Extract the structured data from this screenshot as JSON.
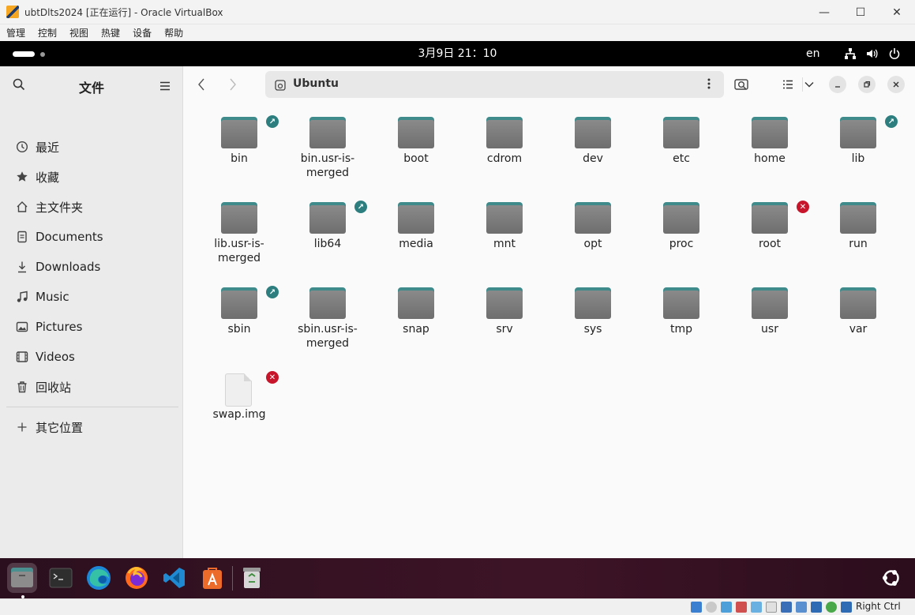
{
  "window": {
    "title": "ubtDlts2024 [正在运行] - Oracle VirtualBox",
    "minimize": "—",
    "maximize": "☐",
    "close": "✕"
  },
  "vbox_menu": [
    "管理",
    "控制",
    "视图",
    "热键",
    "设备",
    "帮助"
  ],
  "topbar": {
    "clock": "3月9日  21：10",
    "lang": "en"
  },
  "sidebar": {
    "title": "文件",
    "items": [
      {
        "label": "最近",
        "icon": "clock-icon"
      },
      {
        "label": "收藏",
        "icon": "star-icon"
      },
      {
        "label": "主文件夹",
        "icon": "home-icon"
      },
      {
        "label": "Documents",
        "icon": "document-icon"
      },
      {
        "label": "Downloads",
        "icon": "download-icon"
      },
      {
        "label": "Music",
        "icon": "music-icon"
      },
      {
        "label": "Pictures",
        "icon": "picture-icon"
      },
      {
        "label": "Videos",
        "icon": "video-icon"
      },
      {
        "label": "回收站",
        "icon": "trash-icon"
      }
    ],
    "other": {
      "label": "其它位置",
      "icon": "plus-icon"
    }
  },
  "pathbar": {
    "location": "Ubuntu"
  },
  "files": [
    {
      "name": "bin",
      "type": "folder",
      "badge": "link"
    },
    {
      "name": "bin.usr-is-merged",
      "type": "folder",
      "badge": ""
    },
    {
      "name": "boot",
      "type": "folder",
      "badge": ""
    },
    {
      "name": "cdrom",
      "type": "folder",
      "badge": ""
    },
    {
      "name": "dev",
      "type": "folder",
      "badge": ""
    },
    {
      "name": "etc",
      "type": "folder",
      "badge": ""
    },
    {
      "name": "home",
      "type": "folder",
      "badge": ""
    },
    {
      "name": "lib",
      "type": "folder",
      "badge": "link"
    },
    {
      "name": "lib.usr-is-merged",
      "type": "folder",
      "badge": ""
    },
    {
      "name": "lib64",
      "type": "folder",
      "badge": "link"
    },
    {
      "name": "media",
      "type": "folder",
      "badge": ""
    },
    {
      "name": "mnt",
      "type": "folder",
      "badge": ""
    },
    {
      "name": "opt",
      "type": "folder",
      "badge": ""
    },
    {
      "name": "proc",
      "type": "folder",
      "badge": ""
    },
    {
      "name": "root",
      "type": "folder",
      "badge": "lock"
    },
    {
      "name": "run",
      "type": "folder",
      "badge": ""
    },
    {
      "name": "sbin",
      "type": "folder",
      "badge": "link"
    },
    {
      "name": "sbin.usr-is-merged",
      "type": "folder",
      "badge": ""
    },
    {
      "name": "snap",
      "type": "folder",
      "badge": ""
    },
    {
      "name": "srv",
      "type": "folder",
      "badge": ""
    },
    {
      "name": "sys",
      "type": "folder",
      "badge": ""
    },
    {
      "name": "tmp",
      "type": "folder",
      "badge": ""
    },
    {
      "name": "usr",
      "type": "folder",
      "badge": ""
    },
    {
      "name": "var",
      "type": "folder",
      "badge": ""
    },
    {
      "name": "swap.img",
      "type": "file",
      "badge": "lock"
    }
  ],
  "dock": [
    "files-app-icon",
    "terminal-app-icon",
    "edge-app-icon",
    "firefox-app-icon",
    "vscode-app-icon",
    "app-center-icon",
    "trash-app-icon"
  ],
  "statusbar": {
    "host_key": "Right Ctrl"
  }
}
